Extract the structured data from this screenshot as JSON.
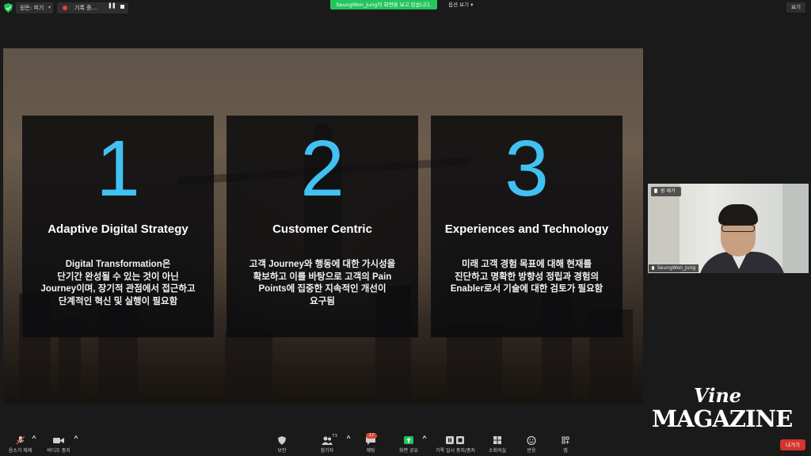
{
  "topbar": {
    "view_label": "원돈: 피기",
    "recording_label": "기록 중...",
    "share_banner": "SeungWon_Jung의 화면을 보고 있습니다.",
    "options_label": "옵션 보기",
    "view_mode_label": "보기"
  },
  "slide": {
    "cards": [
      {
        "number": "1",
        "title": "Adaptive Digital Strategy",
        "lines": [
          "Digital Transformation은",
          "단기간 완성될 수 있는 것이 아닌",
          "Journey이며, 장기적 관점에서 접근하고",
          "단계적인 혁신 및 실행이 필요함"
        ]
      },
      {
        "number": "2",
        "title": "Customer Centric",
        "lines": [
          "고객 Journey와 행동에 대한 가시성을",
          "확보하고 이를 바탕으로 고객의 Pain",
          "Points에 집중한 지속적인 개선이",
          "요구됨"
        ]
      },
      {
        "number": "3",
        "title": "Experiences and Technology",
        "lines": [
          "미래 고객 경험 목표에 대해 현재를",
          "진단하고 명확한 방향성 정립과 경험의",
          "Enabler로서 기술에 대한 검토가 필요함"
        ]
      }
    ]
  },
  "participant": {
    "name": "SeungWon_Jung",
    "mute_label": "원 제거"
  },
  "watermark": {
    "line1": "Vine",
    "line2": "MAGAZINE"
  },
  "toolbar": {
    "audio": "음소거 해제",
    "video": "비디오 중지",
    "security": "보안",
    "participants": "참가자",
    "participants_count": "73",
    "chat": "채팅",
    "chat_badge": "17",
    "share": "화면 공유",
    "record": "기록 일시 중지/중지",
    "breakout": "소회의실",
    "reactions": "반응",
    "apps": "앱",
    "leave": "나가기"
  },
  "colors": {
    "accent_blue": "#41c1f2",
    "share_green": "#23c55e",
    "leave_red": "#d3342d"
  }
}
